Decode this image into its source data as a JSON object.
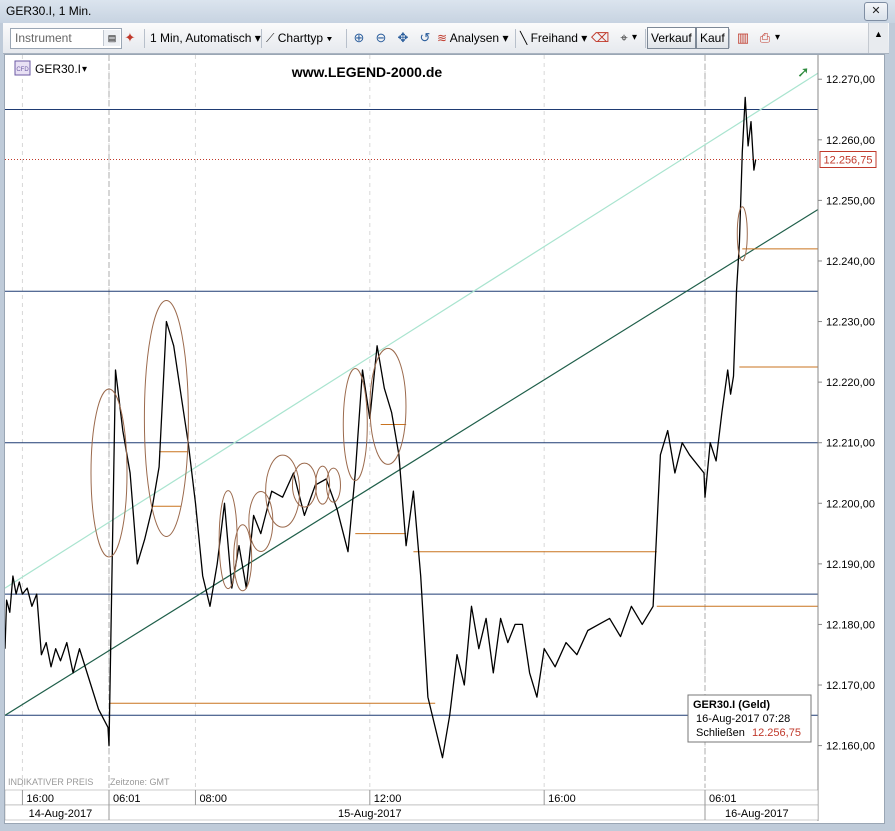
{
  "window": {
    "title": "GER30.I, 1 Min."
  },
  "toolbar": {
    "instrument_placeholder": "Instrument",
    "interval_label": "1 Min, Automatisch",
    "charttype_label": "Charttyp",
    "analysen_label": "Analysen",
    "freihand_label": "Freihand",
    "sell_label": "Verkauf",
    "buy_label": "Kauf"
  },
  "chart_header": {
    "symbol": "GER30.I",
    "watermark": "www.LEGEND-2000.de"
  },
  "tooltip": {
    "title": "GER30.I (Geld)",
    "datetime": "16-Aug-2017 07:28",
    "close_label": "Schließen",
    "close_value": "12.256,75"
  },
  "footer": {
    "indicative": "INDIKATIVER PREIS",
    "timezone": "Zeitzone: GMT"
  },
  "colors": {
    "price_line": "#000000",
    "horizontal_level": "#1f3b73",
    "support_line": "#1f5f4a",
    "upper_channel": "#a9e4cf",
    "session_level": "#c9731f",
    "annotation_ellipse": "#9b6a4d",
    "last_price": "#c0392b"
  },
  "chart_data": {
    "type": "line",
    "title": "GER30.I, 1 Min.",
    "ylim": [
      12153,
      12274
    ],
    "y_ticks": [
      "12.160,00",
      "12.170,00",
      "12.180,00",
      "12.190,00",
      "12.200,00",
      "12.210,00",
      "12.220,00",
      "12.230,00",
      "12.240,00",
      "12.250,00",
      "12.260,00",
      "12.270,00"
    ],
    "y_tick_values": [
      12160,
      12170,
      12180,
      12190,
      12200,
      12210,
      12220,
      12230,
      12240,
      12250,
      12260,
      12270
    ],
    "x_range": [
      "14-Aug-2017 15:05",
      "16-Aug-2017 09:15"
    ],
    "time_ticks": [
      {
        "label": "16:00",
        "t": "14-Aug-2017 16:00"
      },
      {
        "label": "06:01",
        "t": "15-Aug-2017 06:01"
      },
      {
        "label": "08:00",
        "t": "15-Aug-2017 08:00"
      },
      {
        "label": "12:00",
        "t": "15-Aug-2017 12:00"
      },
      {
        "label": "16:00",
        "t": "15-Aug-2017 16:00"
      },
      {
        "label": "06:01",
        "t": "16-Aug-2017 06:01"
      }
    ],
    "date_ticks": [
      {
        "label": "14-Aug-2017",
        "t": "14-Aug-2017 18:00"
      },
      {
        "label": "15-Aug-2017",
        "t": "15-Aug-2017 12:00"
      },
      {
        "label": "16-Aug-2017",
        "t": "16-Aug-2017 07:30"
      }
    ],
    "session_breaks": [
      "15-Aug-2017 06:01",
      "16-Aug-2017 06:01"
    ],
    "series": [
      {
        "points": [
          [
            "14-Aug-2017 15:05",
            12176
          ],
          [
            "14-Aug-2017 15:10",
            12184
          ],
          [
            "14-Aug-2017 15:20",
            12182
          ],
          [
            "14-Aug-2017 15:30",
            12188
          ],
          [
            "14-Aug-2017 15:40",
            12185
          ],
          [
            "14-Aug-2017 15:50",
            12187
          ],
          [
            "14-Aug-2017 16:00",
            12185
          ],
          [
            "14-Aug-2017 16:15",
            12186
          ],
          [
            "14-Aug-2017 16:30",
            12183
          ],
          [
            "14-Aug-2017 16:45",
            12185
          ],
          [
            "14-Aug-2017 17:00",
            12175
          ],
          [
            "14-Aug-2017 17:15",
            12177
          ],
          [
            "14-Aug-2017 17:30",
            12173
          ],
          [
            "14-Aug-2017 17:45",
            12176
          ],
          [
            "14-Aug-2017 18:00",
            12174
          ],
          [
            "14-Aug-2017 18:20",
            12177
          ],
          [
            "14-Aug-2017 18:40",
            12172
          ],
          [
            "14-Aug-2017 19:00",
            12176
          ],
          [
            "14-Aug-2017 19:30",
            12171
          ],
          [
            "14-Aug-2017 20:00",
            12166
          ],
          [
            "14-Aug-2017 20:30",
            12163
          ],
          [
            "15-Aug-2017 06:01",
            12160
          ],
          [
            "15-Aug-2017 06:10",
            12222
          ],
          [
            "15-Aug-2017 06:20",
            12212
          ],
          [
            "15-Aug-2017 06:30",
            12205
          ],
          [
            "15-Aug-2017 06:40",
            12190
          ],
          [
            "15-Aug-2017 06:50",
            12194
          ],
          [
            "15-Aug-2017 07:00",
            12199
          ],
          [
            "15-Aug-2017 07:10",
            12206
          ],
          [
            "15-Aug-2017 07:20",
            12230
          ],
          [
            "15-Aug-2017 07:30",
            12226
          ],
          [
            "15-Aug-2017 07:40",
            12218
          ],
          [
            "15-Aug-2017 07:50",
            12210
          ],
          [
            "15-Aug-2017 08:00",
            12200
          ],
          [
            "15-Aug-2017 08:10",
            12188
          ],
          [
            "15-Aug-2017 08:20",
            12183
          ],
          [
            "15-Aug-2017 08:30",
            12190
          ],
          [
            "15-Aug-2017 08:40",
            12200
          ],
          [
            "15-Aug-2017 08:50",
            12186
          ],
          [
            "15-Aug-2017 09:00",
            12193
          ],
          [
            "15-Aug-2017 09:10",
            12186
          ],
          [
            "15-Aug-2017 09:20",
            12198
          ],
          [
            "15-Aug-2017 09:30",
            12195
          ],
          [
            "15-Aug-2017 09:45",
            12202
          ],
          [
            "15-Aug-2017 10:00",
            12201
          ],
          [
            "15-Aug-2017 10:15",
            12205
          ],
          [
            "15-Aug-2017 10:30",
            12198
          ],
          [
            "15-Aug-2017 10:45",
            12203
          ],
          [
            "15-Aug-2017 11:00",
            12204
          ],
          [
            "15-Aug-2017 11:15",
            12199
          ],
          [
            "15-Aug-2017 11:30",
            12192
          ],
          [
            "15-Aug-2017 11:40",
            12205
          ],
          [
            "15-Aug-2017 11:50",
            12222
          ],
          [
            "15-Aug-2017 12:00",
            12214
          ],
          [
            "15-Aug-2017 12:10",
            12226
          ],
          [
            "15-Aug-2017 12:20",
            12219
          ],
          [
            "15-Aug-2017 12:30",
            12215
          ],
          [
            "15-Aug-2017 12:40",
            12208
          ],
          [
            "15-Aug-2017 12:50",
            12193
          ],
          [
            "15-Aug-2017 13:00",
            12202
          ],
          [
            "15-Aug-2017 13:10",
            12188
          ],
          [
            "15-Aug-2017 13:20",
            12168
          ],
          [
            "15-Aug-2017 13:30",
            12163
          ],
          [
            "15-Aug-2017 13:40",
            12158
          ],
          [
            "15-Aug-2017 13:50",
            12165
          ],
          [
            "15-Aug-2017 14:00",
            12175
          ],
          [
            "15-Aug-2017 14:10",
            12170
          ],
          [
            "15-Aug-2017 14:20",
            12183
          ],
          [
            "15-Aug-2017 14:30",
            12176
          ],
          [
            "15-Aug-2017 14:40",
            12181
          ],
          [
            "15-Aug-2017 14:50",
            12172
          ],
          [
            "15-Aug-2017 15:00",
            12181
          ],
          [
            "15-Aug-2017 15:10",
            12177
          ],
          [
            "15-Aug-2017 15:20",
            12180
          ],
          [
            "15-Aug-2017 15:30",
            12180
          ],
          [
            "15-Aug-2017 15:40",
            12172
          ],
          [
            "15-Aug-2017 15:50",
            12168
          ],
          [
            "15-Aug-2017 16:00",
            12176
          ],
          [
            "15-Aug-2017 16:15",
            12173
          ],
          [
            "15-Aug-2017 16:30",
            12177
          ],
          [
            "15-Aug-2017 16:45",
            12175
          ],
          [
            "15-Aug-2017 17:00",
            12179
          ],
          [
            "15-Aug-2017 17:15",
            12180
          ],
          [
            "15-Aug-2017 17:30",
            12181
          ],
          [
            "15-Aug-2017 17:45",
            12178
          ],
          [
            "15-Aug-2017 18:00",
            12183
          ],
          [
            "15-Aug-2017 18:15",
            12180
          ],
          [
            "15-Aug-2017 18:30",
            12183
          ],
          [
            "15-Aug-2017 18:40",
            12208
          ],
          [
            "15-Aug-2017 18:50",
            12212
          ],
          [
            "15-Aug-2017 19:00",
            12205
          ],
          [
            "15-Aug-2017 19:10",
            12210
          ],
          [
            "15-Aug-2017 19:20",
            12208
          ],
          [
            "15-Aug-2017 19:40",
            12205
          ],
          [
            "16-Aug-2017 06:01",
            12201
          ],
          [
            "16-Aug-2017 06:10",
            12210
          ],
          [
            "16-Aug-2017 06:20",
            12207
          ],
          [
            "16-Aug-2017 06:30",
            12215
          ],
          [
            "16-Aug-2017 06:40",
            12222
          ],
          [
            "16-Aug-2017 06:45",
            12218
          ],
          [
            "16-Aug-2017 06:50",
            12221
          ],
          [
            "16-Aug-2017 06:55",
            12235
          ],
          [
            "16-Aug-2017 07:00",
            12243
          ],
          [
            "16-Aug-2017 07:05",
            12258
          ],
          [
            "16-Aug-2017 07:10",
            12267
          ],
          [
            "16-Aug-2017 07:15",
            12259
          ],
          [
            "16-Aug-2017 07:20",
            12263
          ],
          [
            "16-Aug-2017 07:25",
            12255
          ],
          [
            "16-Aug-2017 07:28",
            12256.75
          ]
        ]
      }
    ],
    "last_price": {
      "label": "12.256,75",
      "value": 12256.75
    },
    "horizontal_levels": [
      12265,
      12235,
      12210,
      12185,
      12165
    ],
    "trend_lines": [
      {
        "kind": "support",
        "from": [
          "14-Aug-2017 15:05",
          12165
        ],
        "to": [
          "16-Aug-2017 09:15",
          12248.5
        ]
      },
      {
        "kind": "upper",
        "from": [
          "14-Aug-2017 15:05",
          12186
        ],
        "to": [
          "16-Aug-2017 09:15",
          12271
        ]
      }
    ],
    "session_levels": [
      {
        "value": 12167,
        "from": "15-Aug-2017 06:01",
        "to": "15-Aug-2017 13:30"
      },
      {
        "value": 12208.5,
        "from": "15-Aug-2017 07:10",
        "to": "15-Aug-2017 07:50"
      },
      {
        "value": 12199.5,
        "from": "15-Aug-2017 07:00",
        "to": "15-Aug-2017 07:40"
      },
      {
        "value": 12213,
        "from": "15-Aug-2017 12:15",
        "to": "15-Aug-2017 12:50"
      },
      {
        "value": 12195,
        "from": "15-Aug-2017 11:40",
        "to": "15-Aug-2017 12:50"
      },
      {
        "value": 12192,
        "from": "15-Aug-2017 13:00",
        "to": "15-Aug-2017 18:35"
      },
      {
        "value": 12183,
        "from": "15-Aug-2017 18:35",
        "to": "16-Aug-2017 09:15"
      },
      {
        "value": 12222.5,
        "from": "16-Aug-2017 07:00",
        "to": "16-Aug-2017 09:15"
      },
      {
        "value": 12242,
        "from": "16-Aug-2017 07:05",
        "to": "16-Aug-2017 09:15"
      }
    ],
    "annotations": [
      {
        "t": "15-Aug-2017 06:01",
        "value": 12205
      },
      {
        "t": "15-Aug-2017 07:20",
        "value": 12214
      },
      {
        "t": "15-Aug-2017 08:45",
        "value": 12194
      },
      {
        "t": "15-Aug-2017 09:05",
        "value": 12191
      },
      {
        "t": "15-Aug-2017 09:30",
        "value": 12197
      },
      {
        "t": "15-Aug-2017 10:00",
        "value": 12202
      },
      {
        "t": "15-Aug-2017 10:30",
        "value": 12203
      },
      {
        "t": "15-Aug-2017 10:55",
        "value": 12203
      },
      {
        "t": "15-Aug-2017 11:10",
        "value": 12203
      },
      {
        "t": "15-Aug-2017 11:40",
        "value": 12213
      },
      {
        "t": "15-Aug-2017 12:25",
        "value": 12216
      },
      {
        "t": "16-Aug-2017 07:05",
        "value": 12244.5
      }
    ]
  }
}
